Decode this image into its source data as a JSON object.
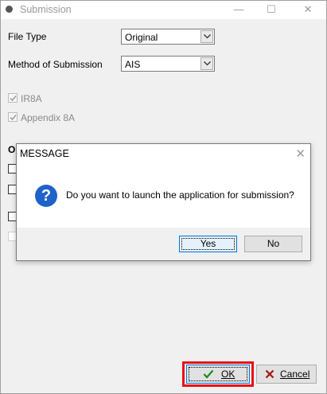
{
  "window": {
    "title": "Submission",
    "minimize": "—",
    "maximize": "☐",
    "close": "✕"
  },
  "form": {
    "file_type": {
      "label": "File Type",
      "value": "Original"
    },
    "method": {
      "label": "Method of Submission",
      "value": "AIS"
    },
    "checks": [
      {
        "label": "IR8A",
        "checked": true
      },
      {
        "label": "Appendix 8A",
        "checked": true
      }
    ],
    "group_label": "O"
  },
  "dialog": {
    "title": "MESSAGE",
    "close": "✕",
    "icon": "?",
    "message": "Do you want to launch the application for submission?",
    "yes": "Yes",
    "no": "No"
  },
  "buttons": {
    "ok": "OK",
    "cancel": "Cancel"
  },
  "colors": {
    "highlight": "#e8101a",
    "question_icon": "#1f63c9",
    "ok_check": "#1b8a1b",
    "cancel_x": "#a31515"
  }
}
